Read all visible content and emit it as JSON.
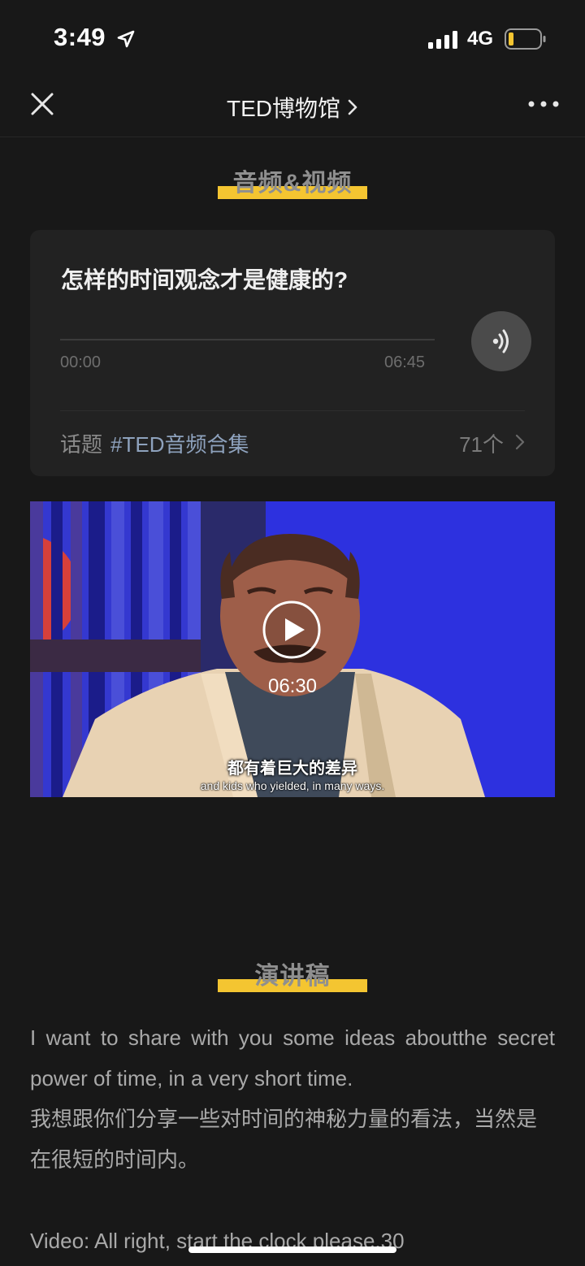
{
  "status_bar": {
    "time": "3:49",
    "network": "4G",
    "icons": [
      "location-arrow-icon",
      "signal-icon",
      "battery-icon"
    ],
    "battery_color": "#f4c531"
  },
  "nav": {
    "title": "TED博物馆",
    "icons": [
      "close-icon",
      "chevron-right-icon",
      "more-icon"
    ]
  },
  "audio_section": {
    "heading": "音频&视频",
    "highlight_color": "#f4c531"
  },
  "audio_card": {
    "title": "怎样的时间观念才是健康的?",
    "current_time": "00:00",
    "duration": "06:45",
    "progress": 0,
    "play_icon": "audio-wave-icon",
    "topic_label": "话题",
    "topic_tag": "#TED音频合集",
    "topic_count": "71个"
  },
  "video": {
    "duration": "06:30",
    "subtitle_cn": "都有着巨大的差异",
    "subtitle_en": "and kids who yielded, in many ways.",
    "play_icon": "play-circle-icon"
  },
  "transcript_section": {
    "heading": "演讲稿",
    "paragraphs": [
      "I want to share with you some ideas aboutthe secret power of time, in a very short time.",
      "我想跟你们分享一些对时间的神秘力量的看法，当然是在很短的时间内。",
      "Video: All right, start the clock please.30"
    ]
  }
}
